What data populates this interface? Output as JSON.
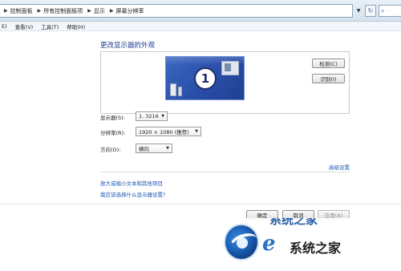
{
  "address_bar": {
    "crumbs": [
      "控制面板",
      "所有控制面板项",
      "显示",
      "屏幕分辨率"
    ],
    "refresh_glyph": "↻",
    "search_glyph": "⌕"
  },
  "menu": [
    "E)",
    "查看(V)",
    "工具(T)",
    "帮助(H)"
  ],
  "main": {
    "title": "更改显示器的外观",
    "monitor_number": "1",
    "detect_button": "检测(C)",
    "identify_button": "识别(I)",
    "display_label": "显示器(S):",
    "display_value": "1. 3216",
    "resolution_label": "分辨率(R):",
    "resolution_value": "1920 × 1080 (推荐)",
    "orientation_label": "方向(O):",
    "orientation_value": "横向",
    "advanced_link": "高级设置",
    "link_text_size": "放大或缩小文本和其他项目",
    "link_help": "我应该选择什么显示器设置?"
  },
  "footer": {
    "ok": "确定",
    "cancel": "取消",
    "apply": "应用(A)"
  },
  "watermark": {
    "text": "系统之家",
    "partial_top": "系统之家"
  },
  "colors": {
    "link": "#1a56b4",
    "title": "#1d3b8c",
    "monitor_blue": "#2a4ea8"
  }
}
